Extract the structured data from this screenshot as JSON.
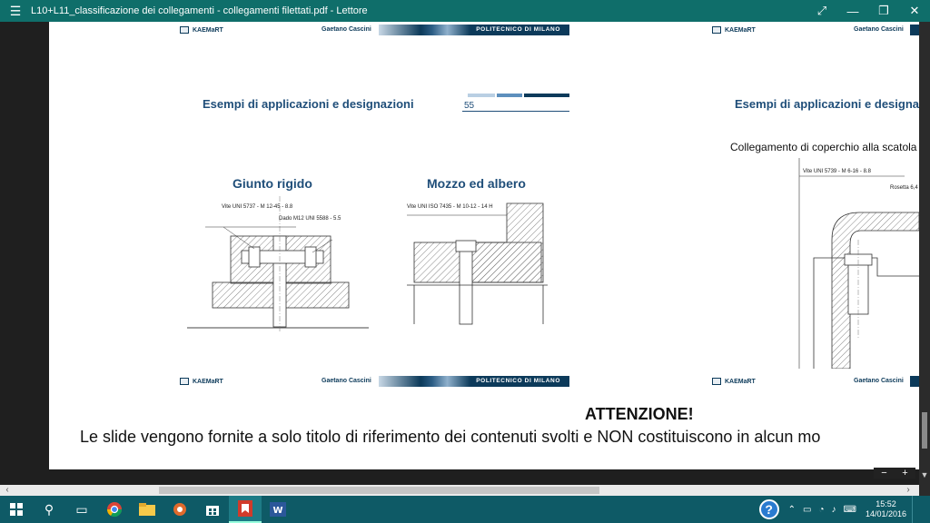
{
  "window": {
    "title": "L10+L11_classificazione dei collegamenti - collegamenti filettati.pdf - Lettore",
    "menu_icon": "hamburger-icon",
    "fullscreen_icon": "expand-icon",
    "minimize_icon": "minimize-icon",
    "restore_icon": "restore-icon",
    "close_icon": "close-icon"
  },
  "slide_left": {
    "header_logo": "KAEMaRT",
    "header_author": "Gaetano Cascini",
    "header_bar": "POLITECNICO DI MILANO",
    "title": "Esempi di applicazioni e designazioni",
    "page_number": "55",
    "section1": "Giunto rigido",
    "section2": "Mozzo ed albero",
    "label_vite1": "Vite UNI 5737 - M 12-45 - 8.8",
    "label_dado": "Dado M12 UNI 5588 - 5.5",
    "label_vite2": "Vite UNI ISO 7435 - M 10-12 - 14 H",
    "footer_logo": "KAEMaRT",
    "footer_author": "Gaetano Cascini",
    "footer_bar": "POLITECNICO DI MILANO"
  },
  "slide_right": {
    "header_logo": "KAEMaRT",
    "header_author": "Gaetano Cascini",
    "title": "Esempi di applicazioni e designazi",
    "subtitle": "Collegamento di coperchio alla scatola",
    "label_vite": "Vite UNI 5739 - M 6-16 - 8.8",
    "label_rosetta": "Rosetta 6,4",
    "footer_logo": "KAEMaRT",
    "footer_author": "Gaetano Cascini"
  },
  "notice": {
    "title": "ATTENZIONE!",
    "text": "Le slide vengono fornite a solo titolo di riferimento dei contenuti svolti e NON costituiscono in alcun mo"
  },
  "zoom": {
    "minus": "−",
    "plus": "+"
  },
  "taskbar": {
    "start_icon": "windows-icon",
    "search_icon": "search-icon",
    "taskview_icon": "task-view-icon",
    "apps": [
      "chrome-icon",
      "file-explorer-icon",
      "app-icon",
      "store-icon",
      "reader-icon",
      "word-icon"
    ],
    "help_label": "?",
    "time": "15:52",
    "date": "14/01/2016"
  }
}
